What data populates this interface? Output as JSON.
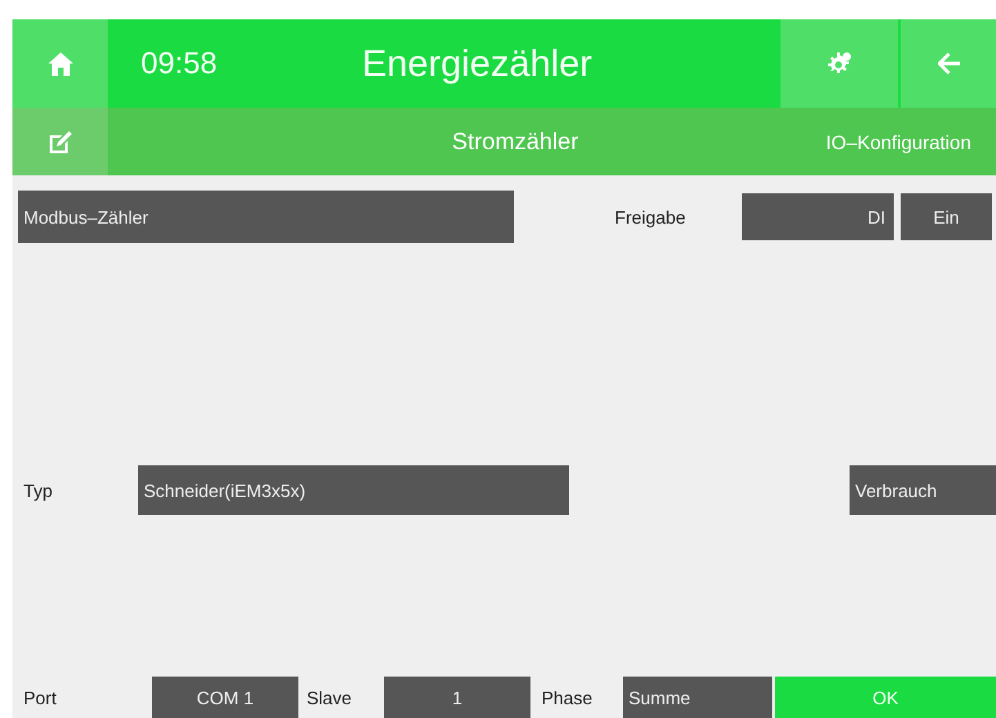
{
  "header": {
    "time": "09:58",
    "title": "Energiezähler"
  },
  "subheader": {
    "title": "Stromzähler",
    "section": "IO–Konfiguration"
  },
  "meter": {
    "name": "Modbus–Zähler",
    "enable_label": "Freigabe",
    "enable_input": "DI",
    "enable_value": "Ein"
  },
  "type": {
    "label": "Typ",
    "value": "Schneider(iEM3x5x)",
    "usage": "Verbrauch"
  },
  "bottom": {
    "port_label": "Port",
    "port": "COM 1",
    "slave_label": "Slave",
    "slave": "1",
    "phase_label": "Phase",
    "phase": "Summe",
    "ok": "OK"
  }
}
